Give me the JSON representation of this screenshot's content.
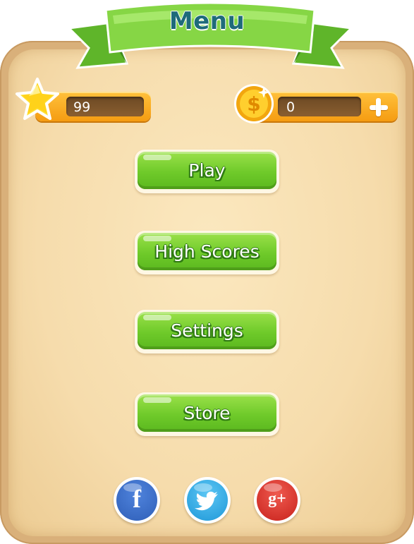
{
  "banner": {
    "title": "Menu"
  },
  "stats": {
    "stars": {
      "value": "99",
      "icon": "star-icon"
    },
    "coins": {
      "value": "0",
      "icon": "dollar-coin-icon"
    },
    "add_icon": "plus-icon"
  },
  "menu": {
    "buttons": [
      {
        "label": "Play"
      },
      {
        "label": "High Scores"
      },
      {
        "label": "Settings"
      },
      {
        "label": "Store"
      }
    ]
  },
  "social": {
    "facebook_glyph": "f",
    "googleplus_glyph": "g+",
    "icons": [
      "facebook-icon",
      "twitter-icon",
      "google-plus-icon"
    ]
  },
  "colors": {
    "parchment": "#f6dcac",
    "ribbon_green": "#7fd13b",
    "button_green": "#6fca2a",
    "title_teal": "#1e6b7a",
    "bar_orange": "#f59c12",
    "facebook_blue": "#2f5fb8",
    "twitter_blue": "#29a9e8",
    "googleplus_red": "#d9302a"
  }
}
